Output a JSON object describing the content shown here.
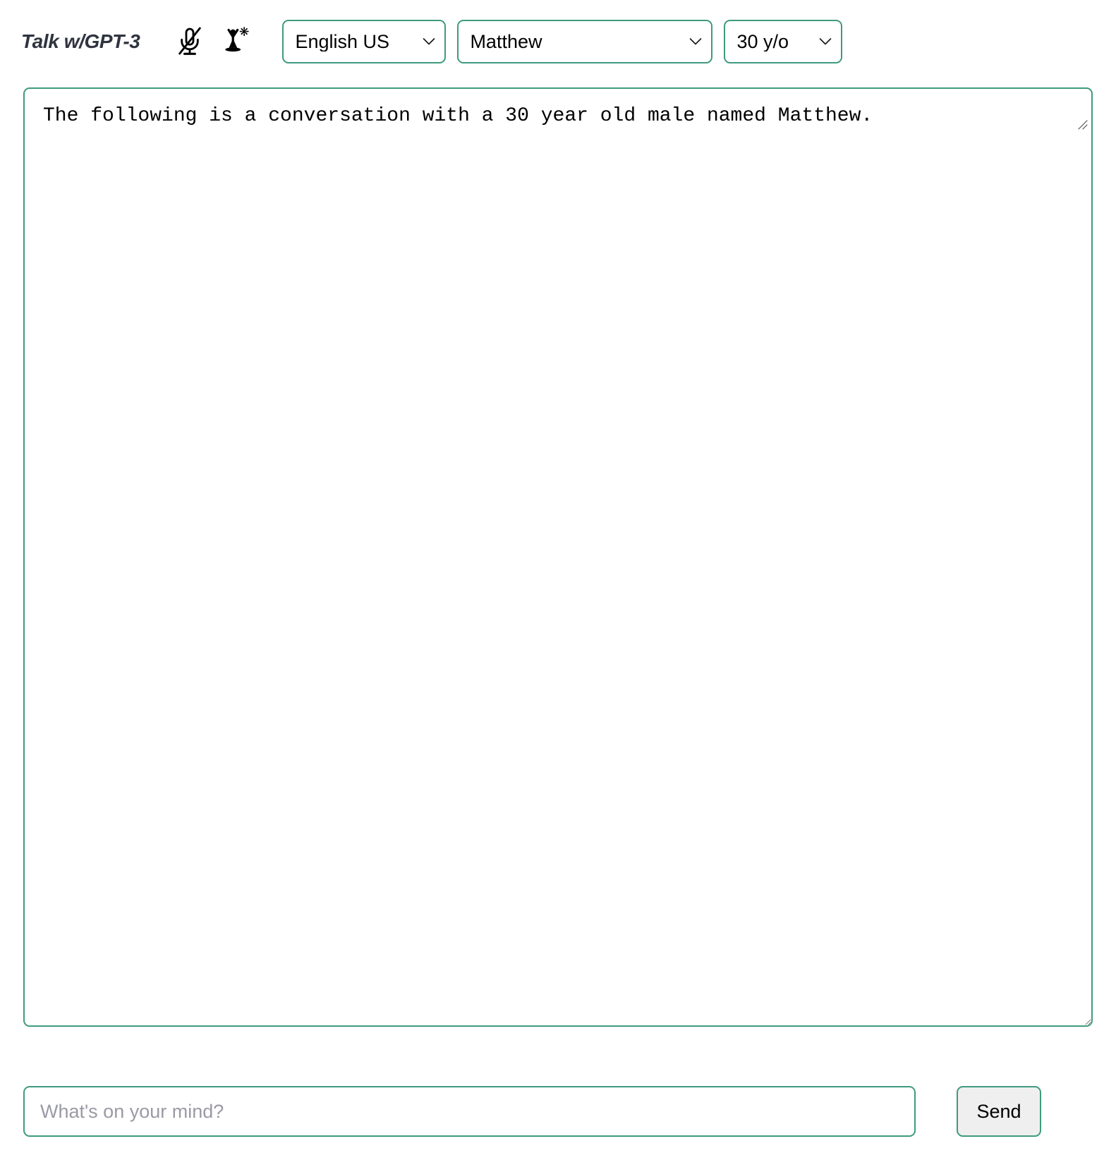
{
  "header": {
    "title": "Talk w/GPT-3",
    "icons": [
      {
        "name": "microphone-muted-icon",
        "label": "Microphone muted"
      },
      {
        "name": "person-raised-arms-icon",
        "label": "Speaking person"
      }
    ],
    "selects": [
      {
        "name": "language-select",
        "value": "English US",
        "options": [
          "English US"
        ]
      },
      {
        "name": "voice-select",
        "value": "Matthew",
        "options": [
          "Matthew"
        ]
      },
      {
        "name": "age-select",
        "value": "30 y/o",
        "options": [
          "30 y/o"
        ]
      }
    ]
  },
  "prompt": {
    "value": "The following is a conversation with a 30 year old male named Matthew.",
    "placeholder": ""
  },
  "composer": {
    "input_value": "",
    "input_placeholder": "What's on your mind?",
    "send_label": "Send"
  },
  "colors": {
    "accent_green": "#3f9a7f",
    "title_text": "#2f3440",
    "placeholder_text": "#9a9aa5",
    "button_bg": "#efefef",
    "page_bg": "#ffffff"
  }
}
